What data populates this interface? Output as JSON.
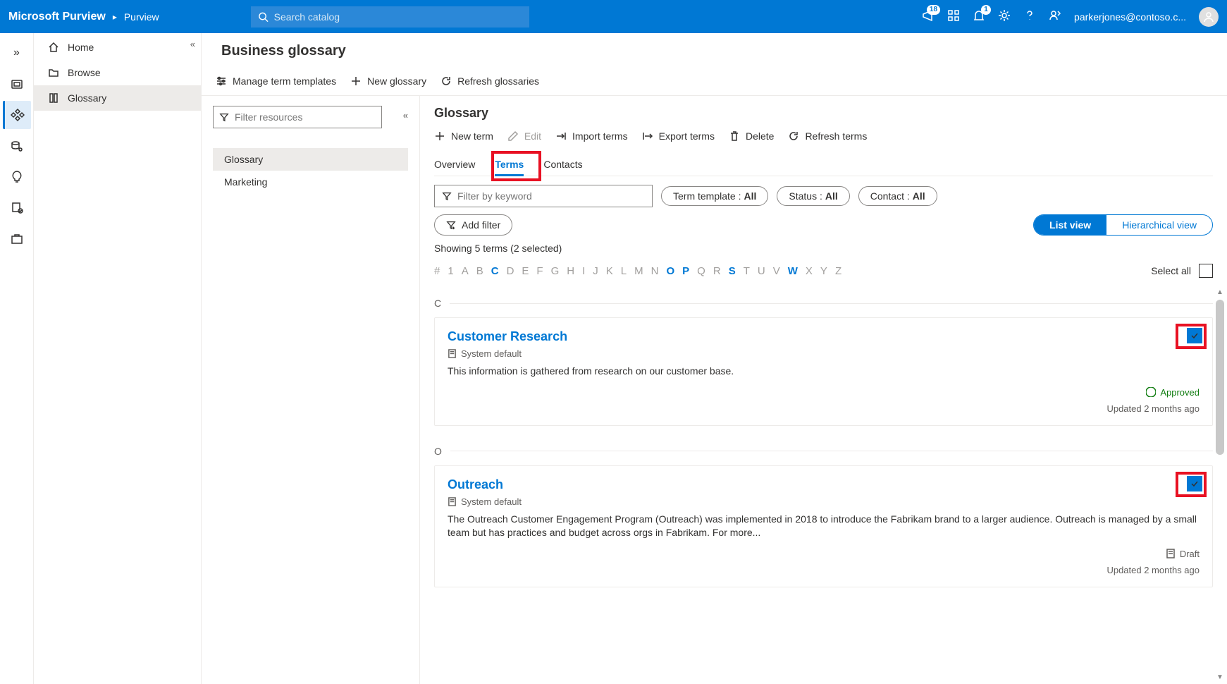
{
  "header": {
    "brand": "Microsoft Purview",
    "breadcrumb": "Purview",
    "search_placeholder": "Search catalog",
    "badges": {
      "megaphone": "18",
      "bell": "1"
    },
    "user_email": "parkerjones@contoso.c..."
  },
  "sidebar": {
    "items": [
      {
        "icon": "home",
        "label": "Home"
      },
      {
        "icon": "folder",
        "label": "Browse"
      },
      {
        "icon": "book",
        "label": "Glossary",
        "active": true
      }
    ]
  },
  "page": {
    "title": "Business glossary",
    "toolbar": {
      "manage_templates": "Manage term templates",
      "new_glossary": "New glossary",
      "refresh": "Refresh glossaries"
    }
  },
  "resources": {
    "filter_placeholder": "Filter resources",
    "items": [
      {
        "label": "Glossary",
        "active": true
      },
      {
        "label": "Marketing"
      }
    ]
  },
  "glossary": {
    "title": "Glossary",
    "toolbar": {
      "new_term": "New term",
      "edit": "Edit",
      "import": "Import terms",
      "export": "Export terms",
      "delete": "Delete",
      "refresh": "Refresh terms"
    },
    "tabs": {
      "overview": "Overview",
      "terms": "Terms",
      "contacts": "Contacts"
    },
    "filters": {
      "keyword_placeholder": "Filter by keyword",
      "template_label": "Term template :",
      "template_value": "All",
      "status_label": "Status :",
      "status_value": "All",
      "contact_label": "Contact :",
      "contact_value": "All",
      "add_filter": "Add filter"
    },
    "view": {
      "list": "List view",
      "hierarchical": "Hierarchical view"
    },
    "showing_text": "Showing 5 terms (2 selected)",
    "alphabet": {
      "letters": [
        "#",
        "1",
        "A",
        "B",
        "C",
        "D",
        "E",
        "F",
        "G",
        "H",
        "I",
        "J",
        "K",
        "L",
        "M",
        "N",
        "O",
        "P",
        "Q",
        "R",
        "S",
        "T",
        "U",
        "V",
        "W",
        "X",
        "Y",
        "Z"
      ],
      "available": [
        "C",
        "O",
        "P",
        "S",
        "W"
      ],
      "select_all": "Select all"
    },
    "sections": [
      {
        "letter": "C",
        "terms": [
          {
            "title": "Customer Research",
            "template": "System default",
            "desc": "This information is gathered from research on our customer base.",
            "status": "Approved",
            "status_type": "approved",
            "updated": "Updated 2 months ago",
            "checked": true
          }
        ]
      },
      {
        "letter": "O",
        "terms": [
          {
            "title": "Outreach",
            "template": "System default",
            "desc": "The Outreach Customer Engagement Program (Outreach) was implemented in 2018 to introduce the Fabrikam brand to a larger audience. Outreach is managed by a small team but has practices and budget across orgs in Fabrikam. For more...",
            "status": "Draft",
            "status_type": "draft",
            "updated": "Updated 2 months ago",
            "checked": true
          }
        ]
      }
    ]
  }
}
